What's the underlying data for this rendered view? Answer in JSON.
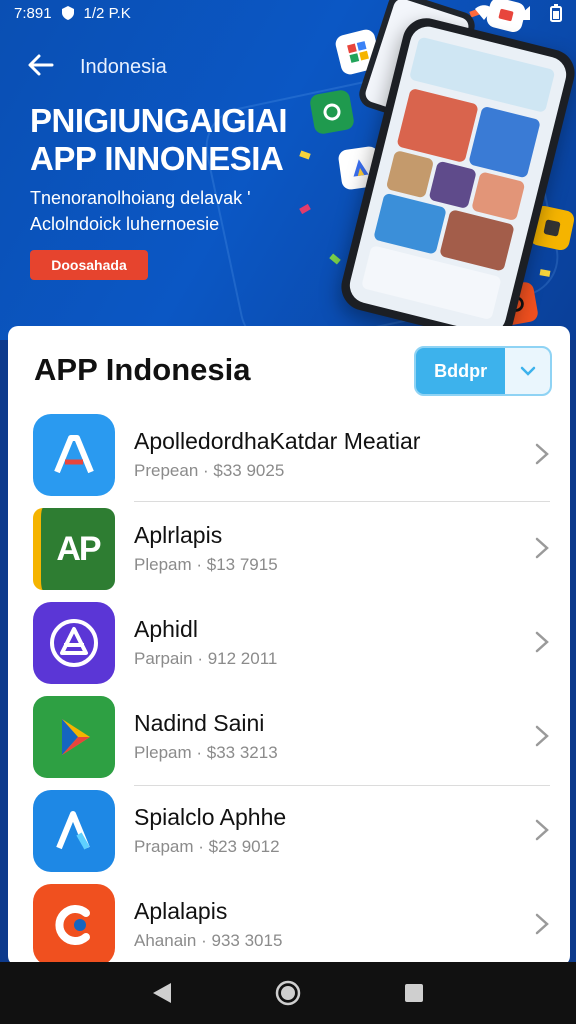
{
  "status_bar": {
    "time": "7:891",
    "extra": "1/2 P.K"
  },
  "hero": {
    "breadcrumb": "Indonesia",
    "title": "PNIGIUNGAIGIAI APP INNONESIA",
    "subtitle": "Tnenoranolhoiang delavak ' Aclolndoick luhernoesie",
    "cta_label": "Doosahada"
  },
  "card": {
    "title": "APP Indonesia",
    "segment_label": "Bddpr"
  },
  "apps": [
    {
      "name": "ApolledordhaKatdar Meatiar",
      "meta": "Prepean · $33 9025",
      "icon": "letter-a-icon",
      "color": "#2a9af0"
    },
    {
      "name": "Aplrlapis",
      "meta": "Plepam · $13 7915",
      "icon": "ap-logo-icon",
      "color": "#2e7d32"
    },
    {
      "name": "Aphidl",
      "meta": "Parpain · 912 2011",
      "icon": "triangle-circle-icon",
      "color": "#5b36d6"
    },
    {
      "name": "Nadind Saini",
      "meta": "Plepam · $33 3213",
      "icon": "play-icon",
      "color": "#2ea043"
    },
    {
      "name": "Spialclo Aphhe",
      "meta": "Prapam · $23 9012",
      "icon": "letter-a-icon",
      "color": "#1e88e5"
    },
    {
      "name": "Aplalapis",
      "meta": "Ahanain · 933 3015",
      "icon": "c-logo-icon",
      "color": "#f0501f"
    }
  ],
  "colors": {
    "hero_bg": "#0b57c4",
    "cta": "#e6442e",
    "segment": "#3db2ec"
  }
}
